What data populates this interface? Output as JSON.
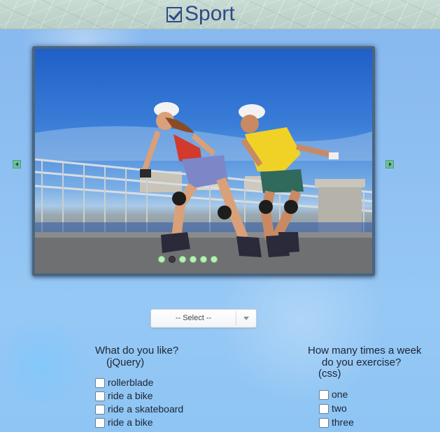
{
  "header": {
    "title": "Sport",
    "icon": "checked-box-icon"
  },
  "slider": {
    "image": "two inline skaters with helmets on a promenade under blue sky",
    "dots_count": 6,
    "active_dot": 2,
    "dot_color": "#b9f0b8",
    "active_dot_color": "#3a3a3a"
  },
  "select": {
    "value": "-- Select --"
  },
  "question_left": {
    "line1": "What do you like?",
    "line2": "(jQuery)",
    "options": [
      "rollerblade",
      "ride a bike",
      "ride a skateboard",
      "ride a bike"
    ]
  },
  "question_right": {
    "line1": "How many times a week",
    "line2": "do you exercise?",
    "line3": "(css)",
    "options": [
      "one",
      "two",
      "three"
    ]
  },
  "colors": {
    "title": "#2f4a86",
    "background": "#8fc0f2",
    "arrow": "#6fbf9b"
  }
}
